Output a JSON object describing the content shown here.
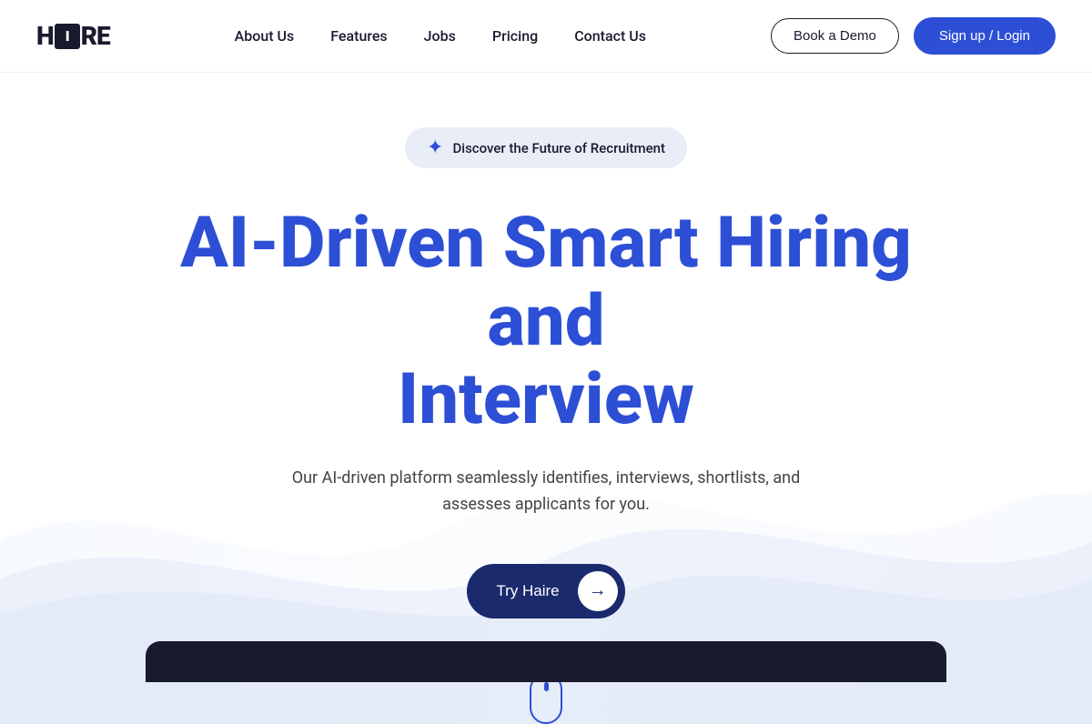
{
  "logo": {
    "prefix": "H",
    "box": "I",
    "suffix": "RE"
  },
  "nav": {
    "links": [
      {
        "id": "about",
        "label": "About Us"
      },
      {
        "id": "features",
        "label": "Features"
      },
      {
        "id": "jobs",
        "label": "Jobs"
      },
      {
        "id": "pricing",
        "label": "Pricing"
      },
      {
        "id": "contact",
        "label": "Contact Us"
      }
    ],
    "btn_demo": "Book a Demo",
    "btn_signup": "Sign up / Login"
  },
  "hero": {
    "badge_text": "Discover the Future of Recruitment",
    "title_line1": "AI-Driven Smart Hiring and",
    "title_line2": "Interview",
    "subtitle": "Our AI-driven platform seamlessly identifies, interviews, shortlists, and assesses applicants for you.",
    "cta_label": "Try Haire",
    "cta_arrow": "→"
  }
}
